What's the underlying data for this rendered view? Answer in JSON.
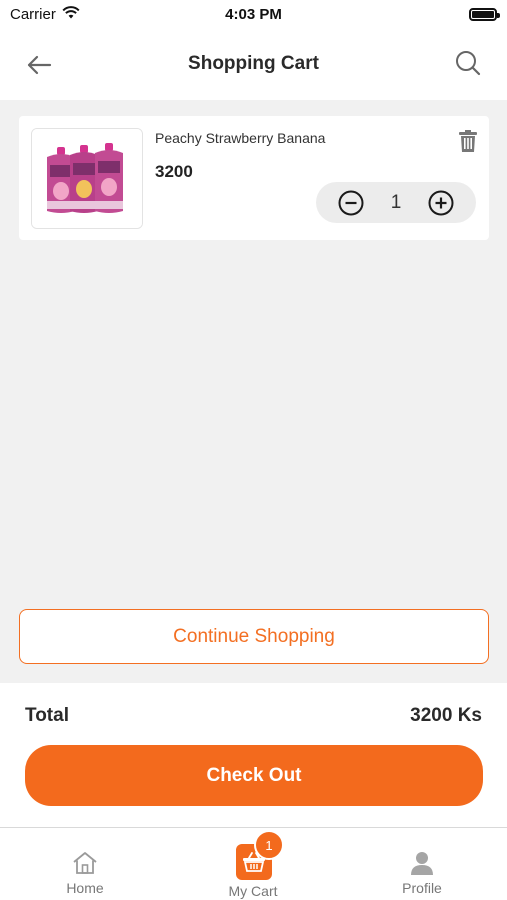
{
  "status_bar": {
    "carrier": "Carrier",
    "time": "4:03 PM"
  },
  "header": {
    "title": "Shopping Cart"
  },
  "cart": {
    "items": [
      {
        "name": "Peachy Strawberry Banana",
        "price": "3200",
        "quantity": "1"
      }
    ]
  },
  "actions": {
    "continue_label": "Continue Shopping",
    "checkout_label": "Check Out"
  },
  "summary": {
    "total_label": "Total",
    "total_value": "3200 Ks"
  },
  "tab_bar": {
    "home_label": "Home",
    "cart_label": "My Cart",
    "cart_badge": "1",
    "profile_label": "Profile"
  },
  "colors": {
    "accent": "#f36a1d",
    "background": "#f1f1f1"
  },
  "icons": [
    "back-arrow-icon",
    "search-icon",
    "trash-icon",
    "minus-circle-icon",
    "plus-circle-icon",
    "home-icon",
    "basket-icon",
    "person-icon",
    "wifi-icon",
    "battery-icon"
  ]
}
